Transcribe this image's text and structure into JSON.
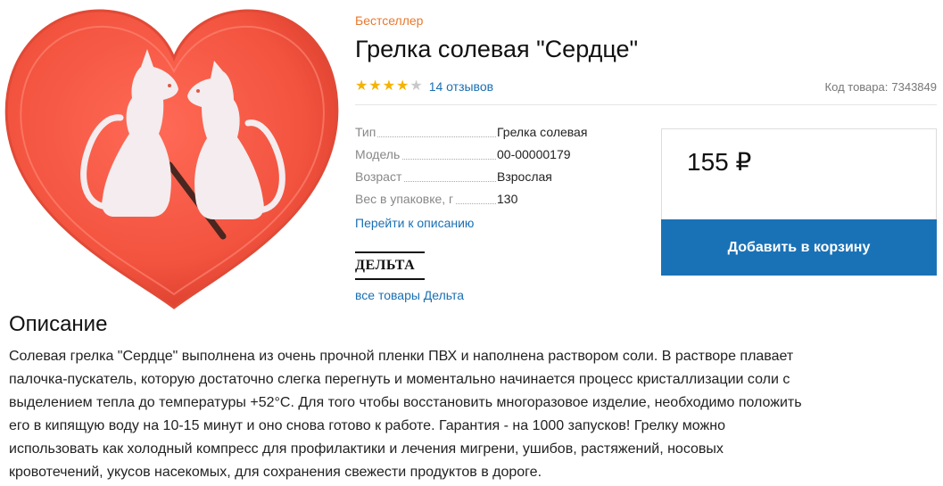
{
  "product": {
    "badge": "Бестселлер",
    "title": "Грелка солевая \"Сердце\"",
    "rating": {
      "value": 4,
      "max": 5,
      "reviews_label": "14 отзывов"
    },
    "sku": {
      "label": "Код товара:",
      "value": "7343849"
    },
    "image": {
      "description": "red heart-shaped heat pad with two white cats",
      "colors": {
        "heart": "#f2533f",
        "cats": "#f4ecee"
      }
    }
  },
  "specs": [
    {
      "label": "Тип",
      "value": "Грелка солевая"
    },
    {
      "label": "Модель",
      "value": "00-00000179"
    },
    {
      "label": "Возраст",
      "value": "Взрослая"
    },
    {
      "label": "Вес в упаковке, г",
      "value": "130"
    }
  ],
  "links": {
    "to_description": "Перейти к описанию",
    "brand_logo": "ДЕЛЬТА",
    "brand_all": "все товары Дельта"
  },
  "buy": {
    "price": "155 ₽",
    "cart_label": "Добавить в корзину",
    "accent": "#1a72b6"
  },
  "description": {
    "heading": "Описание",
    "text": "Солевая грелка \"Сердце\" выполнена из очень прочной пленки ПВХ и наполнена раствором соли. В растворе плавает палочка-пускатель, которую достаточно слегка перегнуть и моментально начинается процесс кристаллизации соли с выделением тепла до температуры +52°С. Для того чтобы восстановить многоразовое изделие, необходимо положить его в кипящую воду на 10-15 минут и оно снова готово к работе. Гарантия - на 1000 запусков! Грелку можно использовать как холодный компресс для профилактики и лечения мигрени, ушибов, растяжений, носовых кровотечений, укусов насекомых, для сохранения свежести продуктов в дороге."
  }
}
